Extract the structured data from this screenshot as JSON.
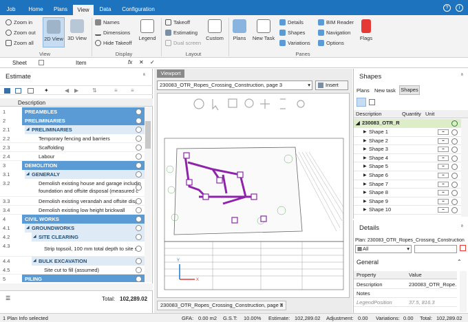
{
  "tabs": [
    "Job",
    "Home",
    "Plans",
    "View",
    "Data",
    "Configuration"
  ],
  "active_tab": "View",
  "ribbon": {
    "view_group": {
      "label": "View",
      "zoom_in": "Zoom in",
      "zoom_out": "Zoom out",
      "zoom_all": "Zoom all",
      "view_2d": "2D View",
      "view_3d": "3D View"
    },
    "display_group": {
      "label": "Display",
      "names": "Names",
      "dimensions": "Dimensions",
      "hide_takeoff": "Hide Takeoff",
      "legend": "Legend"
    },
    "layout_group": {
      "label": "Layout",
      "takeoff": "Takeoff",
      "estimating": "Estimating",
      "dual_screen": "Dual screen",
      "custom": "Custom"
    },
    "panes_group": {
      "label": "Panes",
      "plans": "Plans",
      "new_task": "New Task",
      "details": "Details",
      "shapes": "Shapes",
      "variations": "Variations",
      "bim_reader": "BIM Reader",
      "navigation": "Navigation",
      "options": "Options",
      "flags": "Flags"
    }
  },
  "formula_bar": {
    "sheet": "Sheet",
    "item": "Item",
    "fx": "fx"
  },
  "estimate": {
    "title": "Estimate",
    "column": "Description",
    "total_label": "Total:",
    "total_value": "102,289.02",
    "rows": [
      {
        "num": "1",
        "text": "PREAMBLES",
        "type": "hdr"
      },
      {
        "num": "2",
        "text": "PRELIMINARIES",
        "type": "hdr"
      },
      {
        "num": "2.1",
        "text": "PRELIMINARIES",
        "type": "sub"
      },
      {
        "num": "2.2",
        "text": "Temporary fencing and barriers",
        "type": "item"
      },
      {
        "num": "2.3",
        "text": "Scaffolding",
        "type": "item"
      },
      {
        "num": "2.4",
        "text": "Labour",
        "type": "item"
      },
      {
        "num": "3",
        "text": "DEMOLITION",
        "type": "hdr"
      },
      {
        "num": "3.1",
        "text": "GENERALY",
        "type": "sub"
      },
      {
        "num": "3.2",
        "text": "Demolish existing house and garage includin",
        "text2": "foundation and offsite disposal (measured c",
        "type": "item2"
      },
      {
        "num": "3.3",
        "text": "Demolish existing verandah and offsite dispo",
        "type": "item"
      },
      {
        "num": "3.4",
        "text": "Demolish existing low height brickwall",
        "type": "item"
      },
      {
        "num": "4",
        "text": "CIVIL WORKS",
        "type": "hdr"
      },
      {
        "num": "4.1",
        "text": "GROUNDWORKS",
        "type": "sub"
      },
      {
        "num": "4.2",
        "text": "SITE CLEARING",
        "type": "sub2"
      },
      {
        "num": "4.3",
        "text": "Strip topsoil, 100 mm total depth to site s",
        "type": "item2b"
      },
      {
        "num": "4.4",
        "text": "BULK EXCAVATION",
        "type": "sub2"
      },
      {
        "num": "4.5",
        "text": "Site cut to fill (assumed)",
        "type": "item3"
      },
      {
        "num": "5",
        "text": "PILING",
        "type": "hdr"
      }
    ]
  },
  "viewport": {
    "tab": "Viewport",
    "plan_select": "230083_OTR_Ropes_Crossing_Construction, page 3",
    "insert": "Insert",
    "page_tab": "230083_OTR_Ropes_Crossing_Construction, page 3"
  },
  "shapes": {
    "title": "Shapes",
    "tabs": [
      "Plans",
      "New task",
      "Shapes"
    ],
    "columns": [
      "Description",
      "Quantity",
      "Unit"
    ],
    "group": "230083_OTR_R",
    "items": [
      "Shape 1",
      "Shape 2",
      "Shape 3",
      "Shape 4",
      "Shape 5",
      "Shape 6",
      "Shape 7",
      "Shape 8",
      "Shape 9",
      "Shape 10"
    ]
  },
  "details": {
    "title": "Details",
    "plan_label": "Plan: 230083_OTR_Ropes_Crossing_Construction",
    "filter": "All",
    "section": "General",
    "columns": [
      "Property",
      "Value"
    ],
    "props": [
      {
        "k": "Description",
        "v": "230083_OTR_Rope..."
      },
      {
        "k": "Notes",
        "v": ""
      },
      {
        "k": "LegendPosition",
        "v": "37.5, 816.3"
      }
    ]
  },
  "status": {
    "left": "1 Plan Info selected",
    "gfa_label": "GFA:",
    "gfa": "0.00 m2",
    "gst_label": "G.S.T:",
    "gst": "10.00%",
    "est_label": "Estimate:",
    "est": "102,289.02",
    "adj_label": "Adjustment:",
    "adj": "0.00",
    "var_label": "Variations:",
    "var": "0.00",
    "tot_label": "Total:",
    "tot": "102,289.02"
  },
  "colors": {
    "accent": "#1e73be",
    "markup": "#8e24aa",
    "header_row": "#5b9bd5"
  }
}
